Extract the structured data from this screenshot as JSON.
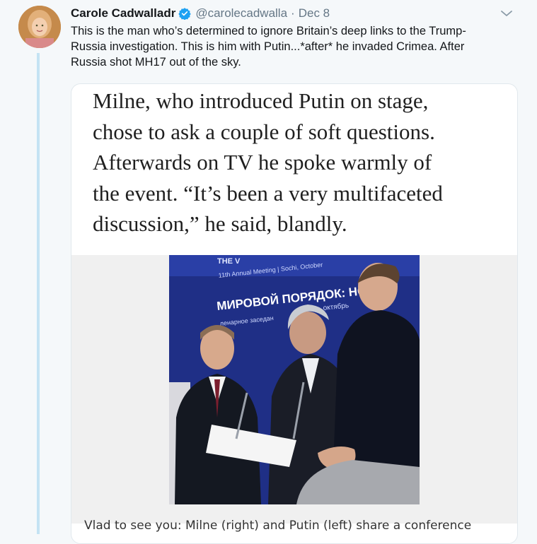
{
  "tweet": {
    "display_name": "Carole Cadwalladr",
    "handle": "@carolecadwalla",
    "separator": "·",
    "date": "Dec 8",
    "text": "This is the man who’s determined to ignore Britain’s deep links to the Trump-\nRussia investigation. This is him with Putin...*after* he invaded Crimea. After\nRussia shot MH17 out of the sky.",
    "icons": {
      "avatar": "avatar",
      "verified": "verified-badge-icon",
      "menu": "chevron-down-icon"
    },
    "colors": {
      "verified": "#1da1f2",
      "thread_line": "#c4e3f3",
      "muted": "#657786"
    }
  },
  "media": {
    "quote": "Milne, who introduced Putin on stage,\nchose to ask a couple of soft questions.\nAfterwards on TV he spoke warmly of\nthe event. “It’s been a very multifaceted\ndiscussion,” he said, blandly.",
    "photo_text": {
      "banner_line1": "THE V",
      "banner_line2": "11th Annual Meeting | Sochi, October",
      "banner_line3": "МИРОВОЙ ПОРЯДОК: НОВ",
      "banner_line4": "ленарное заседан",
      "banner_line5": "октябрь"
    },
    "caption": "Vlad to see you: Milne (right) and Putin (left) share a conference"
  }
}
